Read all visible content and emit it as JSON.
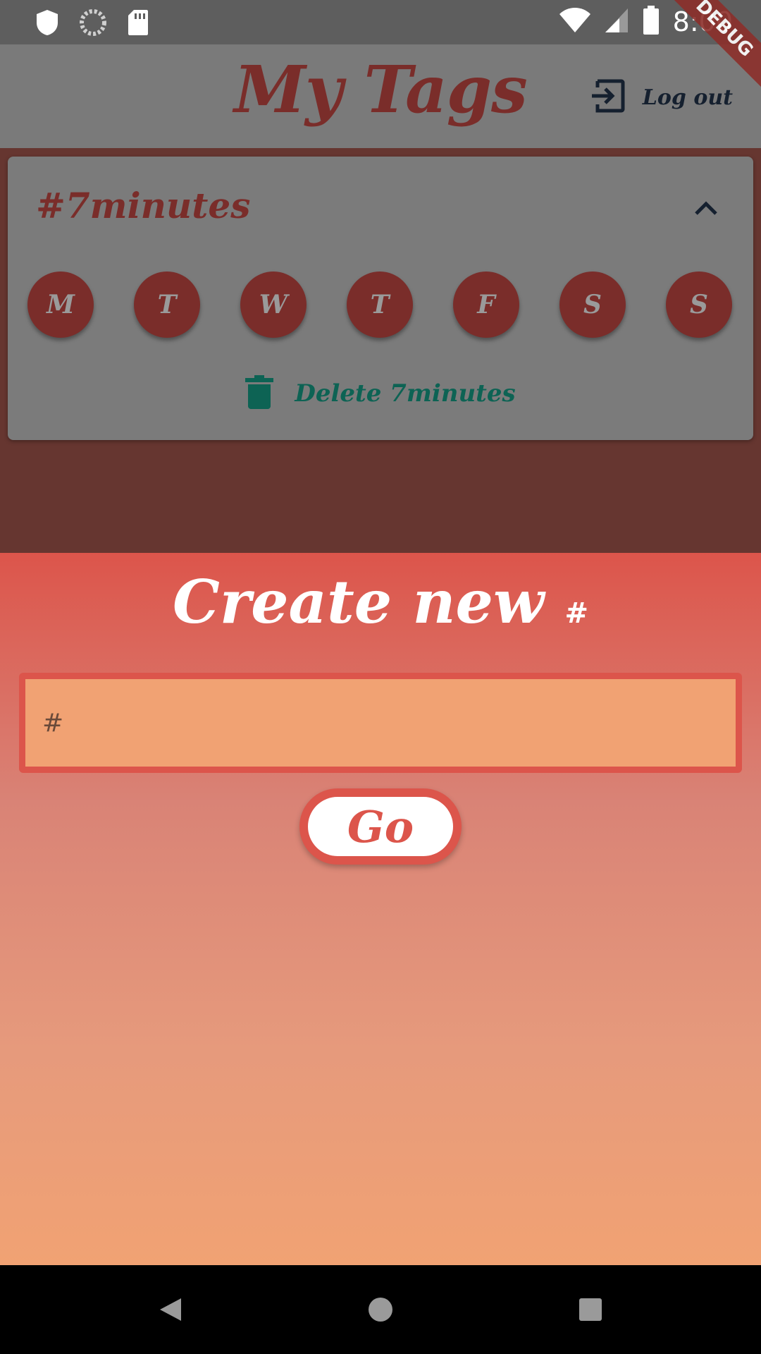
{
  "status_bar": {
    "time": "8:00",
    "icons": [
      "shield-icon",
      "loading-icon",
      "sd-card-icon",
      "wifi-icon",
      "signal-icon",
      "battery-icon"
    ]
  },
  "debug_banner": "DEBUG",
  "app_bar": {
    "title": "My Tags",
    "logout_label": "Log out",
    "logout_icon": "logout-icon"
  },
  "tag_card": {
    "tag_name": "#7minutes",
    "collapse_icon": "chevron-up-icon",
    "days": [
      "M",
      "T",
      "W",
      "T",
      "F",
      "S",
      "S"
    ],
    "delete_label": "Delete 7minutes",
    "delete_icon": "trash-icon"
  },
  "create_sheet": {
    "title": "Create new",
    "title_hash": "#",
    "input_placeholder": "#",
    "input_value": "",
    "go_label": "Go"
  },
  "colors": {
    "accent": "#dc554b",
    "tag_dark": "#7a2d2a",
    "delete_green": "#0d6354",
    "input_bg": "#f1a273"
  },
  "nav_bar": {
    "buttons": [
      "back-icon",
      "home-icon",
      "recents-icon"
    ]
  }
}
